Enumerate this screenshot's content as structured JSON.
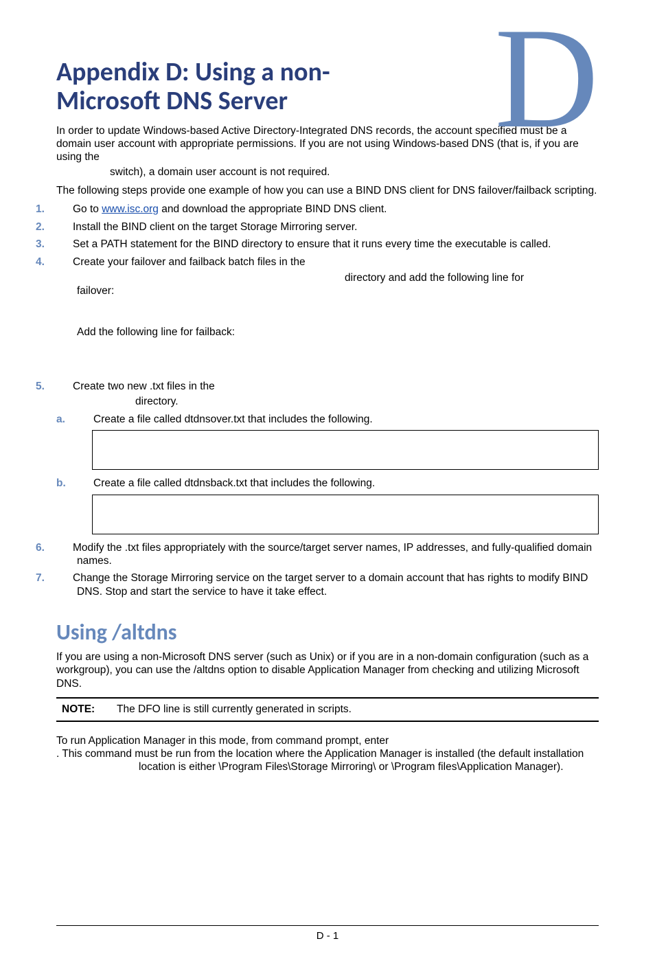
{
  "bigLetter": "D",
  "title": "Appendix D: Using a non-Microsoft DNS Server",
  "intro1": "In order to update Windows-based Active Directory-Integrated DNS records, the account specified must be a domain user account with appropriate permissions. If you are not using Windows-based DNS (that is, if you are using the",
  "intro1b": "switch), a domain user account is not required.",
  "intro2": "The following steps provide one example of how you can use a BIND DNS client for DNS failover/failback scripting.",
  "steps": {
    "m1": "1.",
    "t1a": "Go to ",
    "t1link": "www.isc.org",
    "t1b": " and download the appropriate BIND DNS client.",
    "m2": "2.",
    "t2": "Install the BIND client on the target Storage Mirroring server.",
    "m3": "3.",
    "t3": "Set a PATH statement for the BIND directory to ensure that it runs every time the executable is called.",
    "m4": "4.",
    "t4a": "Create your failover and failback batch files in the",
    "t4b": "directory and add the following line for",
    "t4c": "failover:",
    "t4d": "Add the following line for failback:",
    "m5": "5.",
    "t5a": "Create two new .txt files in the",
    "t5b": "directory.",
    "ma": "a.",
    "ta": "Create a file called dtdnsover.txt that includes the following.",
    "mb": "b.",
    "tb": "Create a file called dtdnsback.txt that includes the following.",
    "m6": "6.",
    "t6": "Modify the .txt files appropriately with the source/target server names, IP addresses, and fully-qualified domain names.",
    "m7": "7.",
    "t7": "Change the Storage Mirroring service on the target server to a domain account that has rights to modify BIND DNS. Stop and start the service to have it take effect."
  },
  "section2": {
    "title": "Using /altdns",
    "p1": "If you are using a non-Microsoft DNS server (such as Unix) or if you are in a non-domain configuration (such as a workgroup), you can use the /altdns option to disable Application Manager from checking and utilizing Microsoft DNS.",
    "noteLabel": "NOTE:",
    "noteText": "The DFO line is still currently generated in scripts.",
    "p2a": "To run Application Manager in this mode, from command prompt, enter",
    "p2b": ". This command must be run from the location where the Application Manager is installed (the default installation location is either \\Program Files\\Storage Mirroring\\ or \\Program files\\Application Manager)."
  },
  "footer": "D - 1"
}
